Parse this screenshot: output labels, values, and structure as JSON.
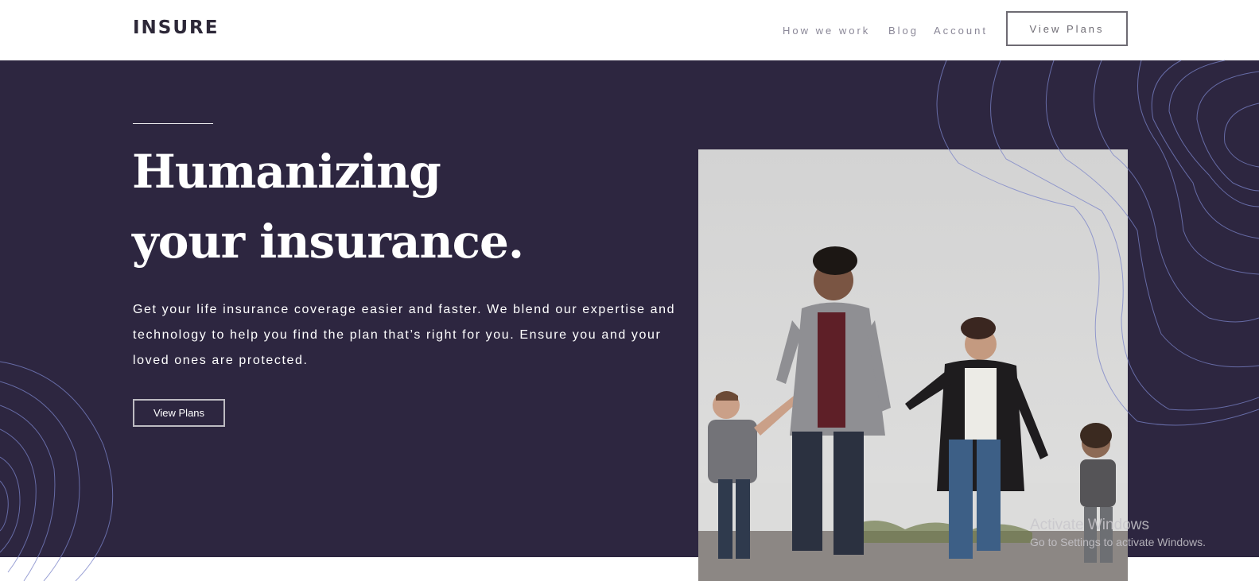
{
  "header": {
    "logo": "INSURE",
    "nav": [
      {
        "label": "How we work"
      },
      {
        "label": "Blog"
      },
      {
        "label": "Account"
      }
    ],
    "cta_label": "View Plans"
  },
  "hero": {
    "headline_line1": "Humanizing",
    "headline_line2": "your insurance.",
    "lead": "Get your life insurance coverage easier and faster. We blend our expertise and technology to help you find the plan that’s right for you. Ensure you and your loved ones are protected.",
    "cta_label": "View Plans",
    "image": "family-walking-photo"
  },
  "watermark": {
    "title": "Activate Windows",
    "subtitle": "Go to Settings to activate Windows."
  },
  "colors": {
    "hero_bg": "#2d2640",
    "text_dark": "#2d2838",
    "nav_text": "#8a8797",
    "contour": "#7a83c8"
  }
}
